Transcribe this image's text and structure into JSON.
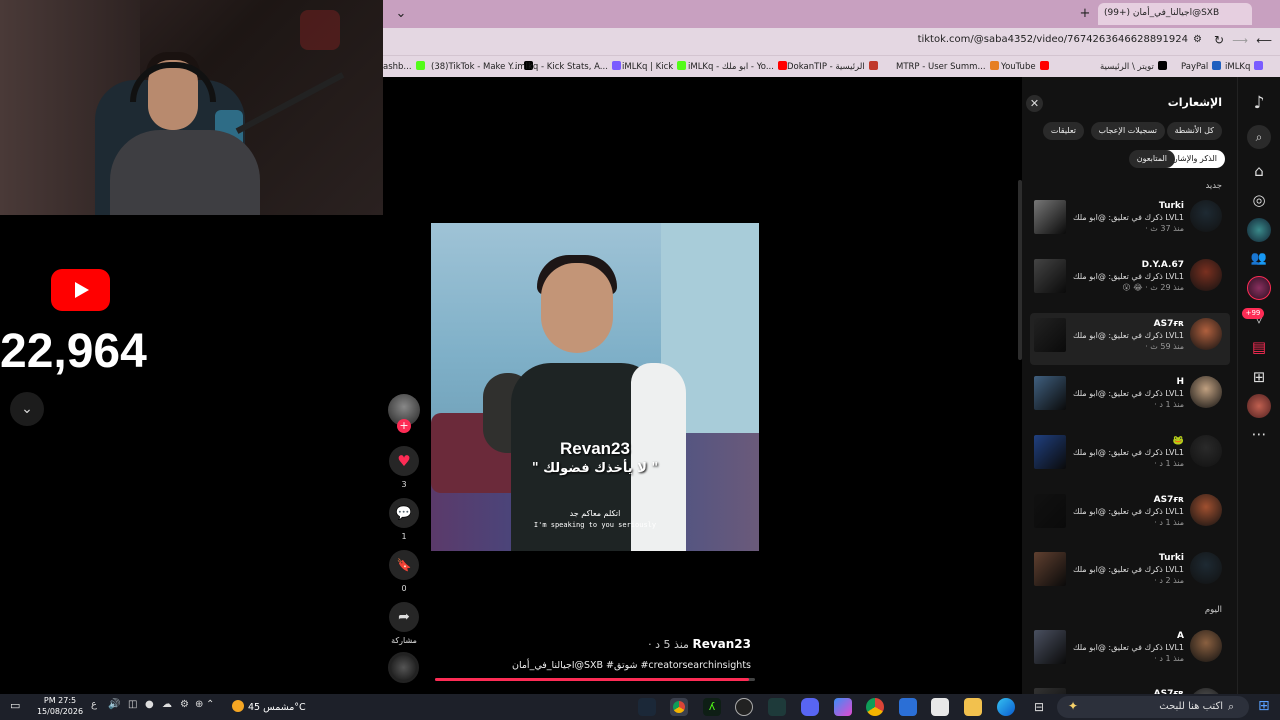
{
  "browser": {
    "tab_title": "(99+) اجيالنا_في_أمان@SXB",
    "url": "tiktok.com/@saba4352/video/7674263646628891924",
    "bookmarks": [
      {
        "label": "ashb...",
        "color": "#53fc18"
      },
      {
        "label": "(38)TikTok - Make Y...",
        "color": "#000000"
      },
      {
        "label": "imlkq - Kick Stats, A...",
        "color": "#7a5cff"
      },
      {
        "label": "iMLKq | Kick",
        "color": "#53fc18"
      },
      {
        "label": "iMLKq - ابو ملك - Yo...",
        "color": "#ff0000"
      },
      {
        "label": "DokanTIP - الرئيسية",
        "color": "#c0392b"
      },
      {
        "label": "MTRP - User Summ...",
        "color": "#e67e22"
      },
      {
        "label": "YouTube",
        "color": "#ff0000"
      },
      {
        "label": "تويتر \\ الرئيسية",
        "color": "#000000"
      },
      {
        "label": "PayPal",
        "color": "#1f5fbf"
      },
      {
        "label": "iMLKq",
        "color": "#7a5cff"
      }
    ]
  },
  "stream": {
    "subscriber_count": "22,964"
  },
  "video": {
    "overlay_name": "Revan23",
    "overlay_caption": "\" لا يأخذك فضولك \"",
    "subtitle_ar": "اتكلم معاكم جد",
    "subtitle_en": "I'm speaking to you seriously",
    "likes": "3",
    "comments": "1",
    "saves": "0",
    "share_label": "مشاركة",
    "author": "Revan23",
    "posted": "· منذ 5 د",
    "description": "اجيالنا_في_أمان@SXB #شوتق #creatorsearchinsights",
    "progress_fraction": 0.98
  },
  "notifications": {
    "title": "الإشعارات",
    "filters": [
      {
        "label": "كل الأنشطة",
        "active": false
      },
      {
        "label": "تسجيلات الإعجاب",
        "active": false
      },
      {
        "label": "تعليقات",
        "active": false
      },
      {
        "label": "الذكر والإشارات",
        "active": true
      },
      {
        "label": "المتابعون",
        "active": false
      }
    ],
    "section_new": "جديد",
    "section_today": "اليوم",
    "items": [
      {
        "name": "Turki",
        "text": "ذكرك في تعليق: @ابو ملك LVL1",
        "time": "· منذ 37 ث"
      },
      {
        "name": "D.Y.A.67",
        "text": "ذكرك في تعليق: @ابو ملك LVL1",
        "time": "😮 😂 · منذ 29 ث"
      },
      {
        "name": "AS7ғʀ",
        "text": "ذكرك في تعليق: @ابو ملك LVL1",
        "time": "· منذ 59 ث"
      },
      {
        "name": "H",
        "text": "ذكرك في تعليق: @ابو ملك LVL1",
        "time": "· منذ 1 د"
      },
      {
        "name": "🐸",
        "text": "ذكرك في تعليق: @ابو ملك LVL1",
        "time": "· منذ 1 د"
      },
      {
        "name": "AS7ғʀ",
        "text": "ذكرك في تعليق: @ابو ملك LVL1",
        "time": "· منذ 1 د"
      },
      {
        "name": "Turki",
        "text": "ذكرك في تعليق: @ابو ملك LVL1",
        "time": "· منذ 2 د"
      },
      {
        "name": "A",
        "text": "ذكرك في تعليق: @ابو ملك LVL1",
        "time": "· منذ 1 د"
      },
      {
        "name": "AS7ғʀ",
        "text": "",
        "time": ""
      }
    ]
  },
  "sidebar": {
    "badge": "+99"
  },
  "taskbar": {
    "search_placeholder": "اكتب هنا للبحث",
    "weather": "مشمس 45°C",
    "time": "PM 27:5",
    "date": "15/08/2026",
    "lang": "ع"
  }
}
